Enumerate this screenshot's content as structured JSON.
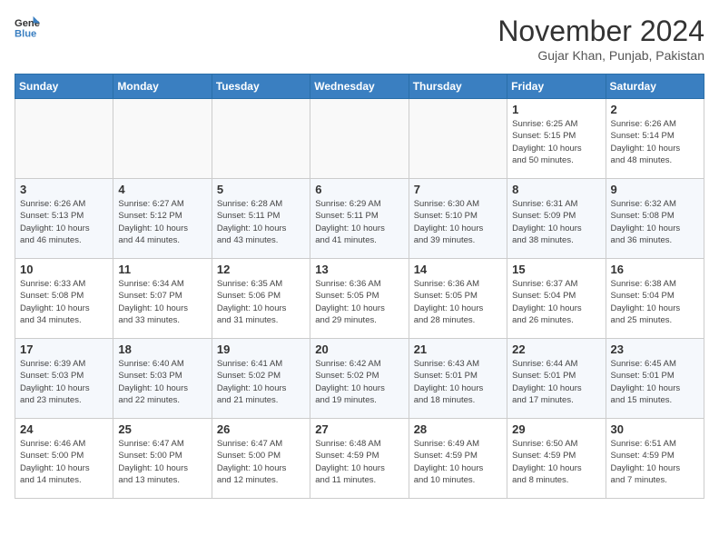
{
  "header": {
    "logo_general": "General",
    "logo_blue": "Blue",
    "month_title": "November 2024",
    "location": "Gujar Khan, Punjab, Pakistan"
  },
  "weekdays": [
    "Sunday",
    "Monday",
    "Tuesday",
    "Wednesday",
    "Thursday",
    "Friday",
    "Saturday"
  ],
  "weeks": [
    [
      {
        "day": "",
        "info": ""
      },
      {
        "day": "",
        "info": ""
      },
      {
        "day": "",
        "info": ""
      },
      {
        "day": "",
        "info": ""
      },
      {
        "day": "",
        "info": ""
      },
      {
        "day": "1",
        "info": "Sunrise: 6:25 AM\nSunset: 5:15 PM\nDaylight: 10 hours\nand 50 minutes."
      },
      {
        "day": "2",
        "info": "Sunrise: 6:26 AM\nSunset: 5:14 PM\nDaylight: 10 hours\nand 48 minutes."
      }
    ],
    [
      {
        "day": "3",
        "info": "Sunrise: 6:26 AM\nSunset: 5:13 PM\nDaylight: 10 hours\nand 46 minutes."
      },
      {
        "day": "4",
        "info": "Sunrise: 6:27 AM\nSunset: 5:12 PM\nDaylight: 10 hours\nand 44 minutes."
      },
      {
        "day": "5",
        "info": "Sunrise: 6:28 AM\nSunset: 5:11 PM\nDaylight: 10 hours\nand 43 minutes."
      },
      {
        "day": "6",
        "info": "Sunrise: 6:29 AM\nSunset: 5:11 PM\nDaylight: 10 hours\nand 41 minutes."
      },
      {
        "day": "7",
        "info": "Sunrise: 6:30 AM\nSunset: 5:10 PM\nDaylight: 10 hours\nand 39 minutes."
      },
      {
        "day": "8",
        "info": "Sunrise: 6:31 AM\nSunset: 5:09 PM\nDaylight: 10 hours\nand 38 minutes."
      },
      {
        "day": "9",
        "info": "Sunrise: 6:32 AM\nSunset: 5:08 PM\nDaylight: 10 hours\nand 36 minutes."
      }
    ],
    [
      {
        "day": "10",
        "info": "Sunrise: 6:33 AM\nSunset: 5:08 PM\nDaylight: 10 hours\nand 34 minutes."
      },
      {
        "day": "11",
        "info": "Sunrise: 6:34 AM\nSunset: 5:07 PM\nDaylight: 10 hours\nand 33 minutes."
      },
      {
        "day": "12",
        "info": "Sunrise: 6:35 AM\nSunset: 5:06 PM\nDaylight: 10 hours\nand 31 minutes."
      },
      {
        "day": "13",
        "info": "Sunrise: 6:36 AM\nSunset: 5:05 PM\nDaylight: 10 hours\nand 29 minutes."
      },
      {
        "day": "14",
        "info": "Sunrise: 6:36 AM\nSunset: 5:05 PM\nDaylight: 10 hours\nand 28 minutes."
      },
      {
        "day": "15",
        "info": "Sunrise: 6:37 AM\nSunset: 5:04 PM\nDaylight: 10 hours\nand 26 minutes."
      },
      {
        "day": "16",
        "info": "Sunrise: 6:38 AM\nSunset: 5:04 PM\nDaylight: 10 hours\nand 25 minutes."
      }
    ],
    [
      {
        "day": "17",
        "info": "Sunrise: 6:39 AM\nSunset: 5:03 PM\nDaylight: 10 hours\nand 23 minutes."
      },
      {
        "day": "18",
        "info": "Sunrise: 6:40 AM\nSunset: 5:03 PM\nDaylight: 10 hours\nand 22 minutes."
      },
      {
        "day": "19",
        "info": "Sunrise: 6:41 AM\nSunset: 5:02 PM\nDaylight: 10 hours\nand 21 minutes."
      },
      {
        "day": "20",
        "info": "Sunrise: 6:42 AM\nSunset: 5:02 PM\nDaylight: 10 hours\nand 19 minutes."
      },
      {
        "day": "21",
        "info": "Sunrise: 6:43 AM\nSunset: 5:01 PM\nDaylight: 10 hours\nand 18 minutes."
      },
      {
        "day": "22",
        "info": "Sunrise: 6:44 AM\nSunset: 5:01 PM\nDaylight: 10 hours\nand 17 minutes."
      },
      {
        "day": "23",
        "info": "Sunrise: 6:45 AM\nSunset: 5:01 PM\nDaylight: 10 hours\nand 15 minutes."
      }
    ],
    [
      {
        "day": "24",
        "info": "Sunrise: 6:46 AM\nSunset: 5:00 PM\nDaylight: 10 hours\nand 14 minutes."
      },
      {
        "day": "25",
        "info": "Sunrise: 6:47 AM\nSunset: 5:00 PM\nDaylight: 10 hours\nand 13 minutes."
      },
      {
        "day": "26",
        "info": "Sunrise: 6:47 AM\nSunset: 5:00 PM\nDaylight: 10 hours\nand 12 minutes."
      },
      {
        "day": "27",
        "info": "Sunrise: 6:48 AM\nSunset: 4:59 PM\nDaylight: 10 hours\nand 11 minutes."
      },
      {
        "day": "28",
        "info": "Sunrise: 6:49 AM\nSunset: 4:59 PM\nDaylight: 10 hours\nand 10 minutes."
      },
      {
        "day": "29",
        "info": "Sunrise: 6:50 AM\nSunset: 4:59 PM\nDaylight: 10 hours\nand 8 minutes."
      },
      {
        "day": "30",
        "info": "Sunrise: 6:51 AM\nSunset: 4:59 PM\nDaylight: 10 hours\nand 7 minutes."
      }
    ]
  ]
}
